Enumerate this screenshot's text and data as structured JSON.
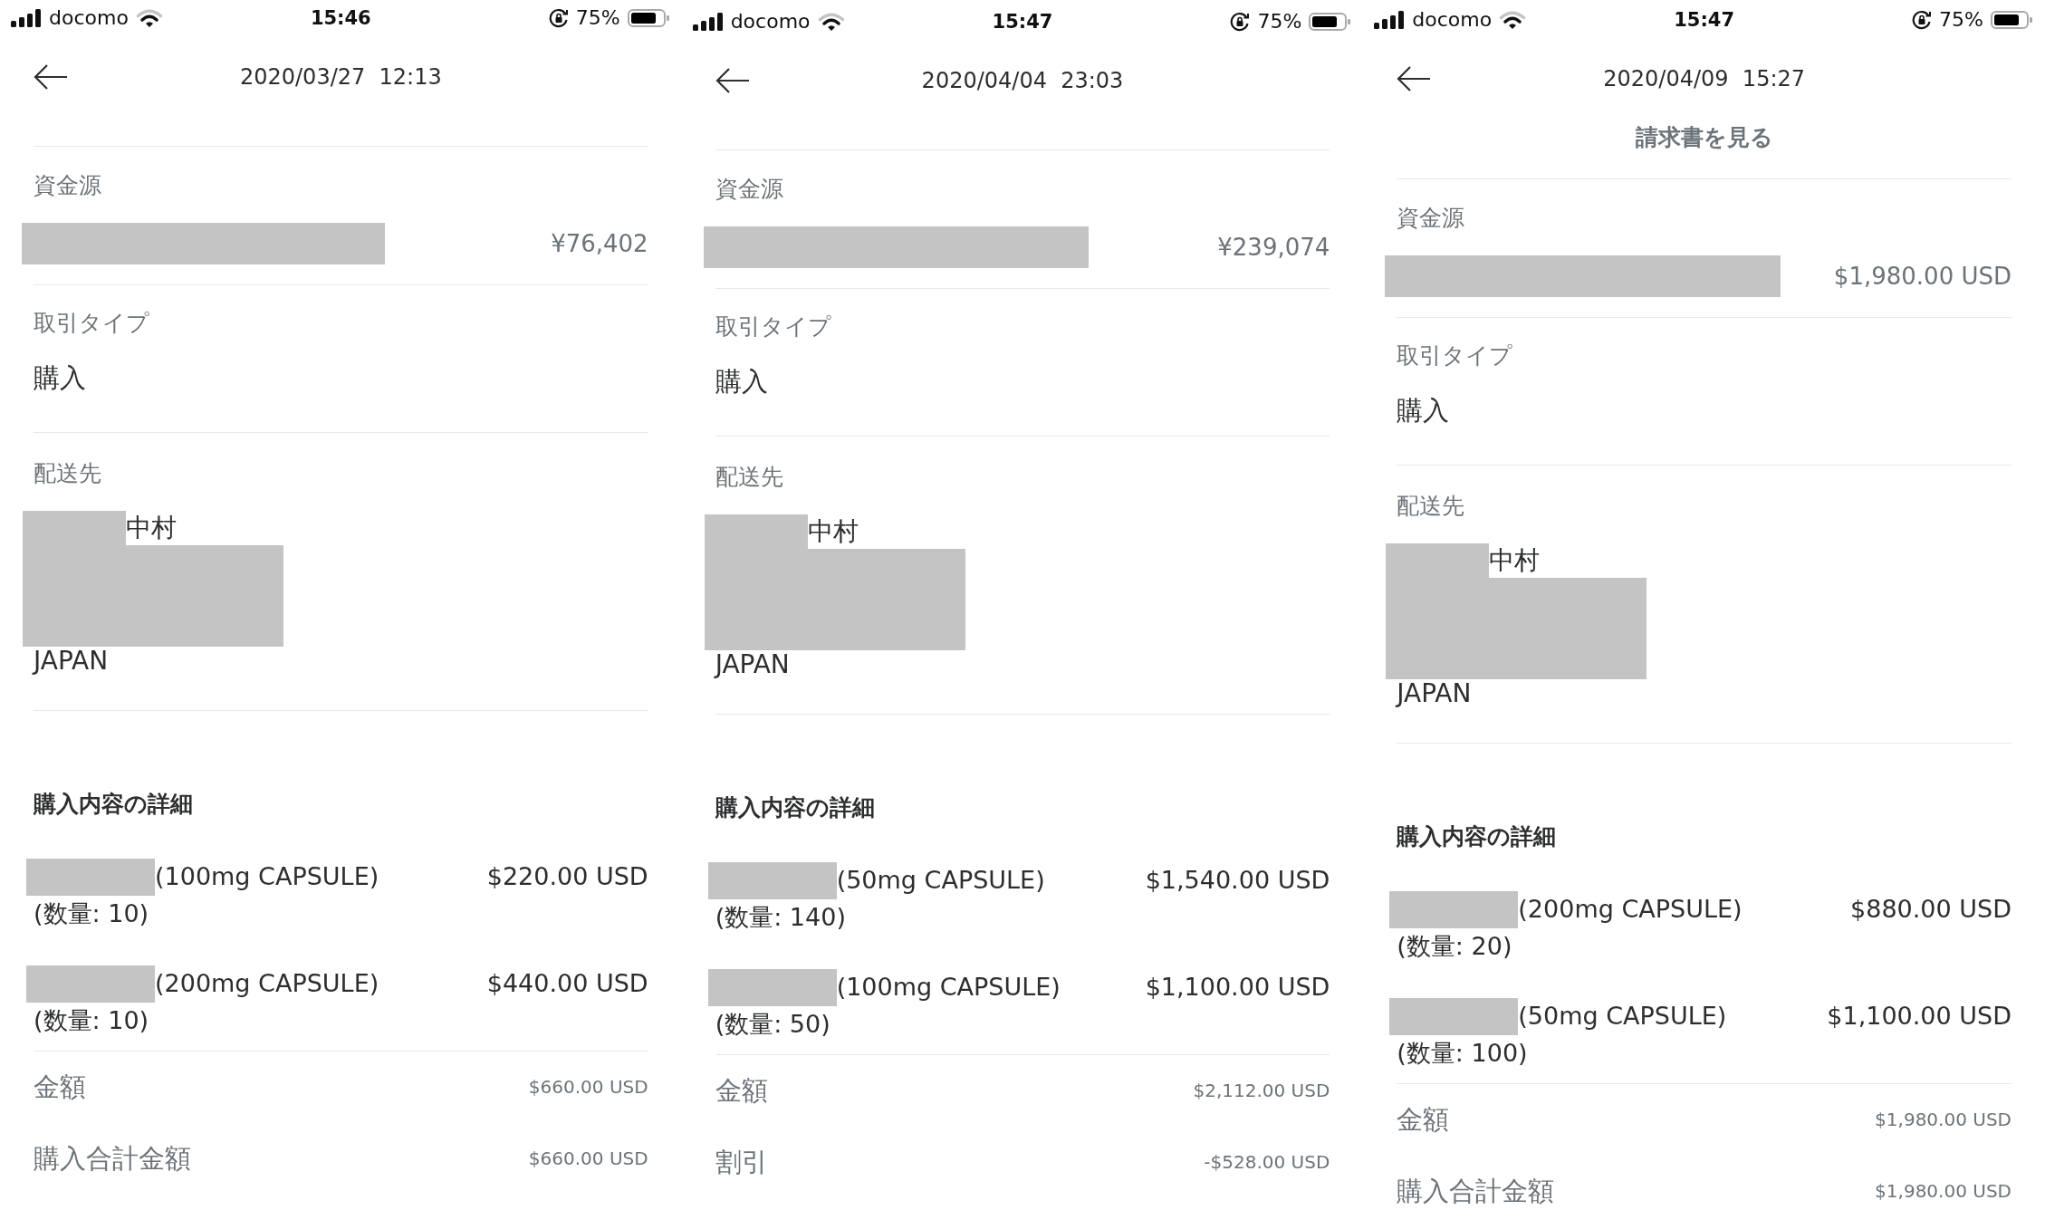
{
  "screens": [
    {
      "status_bar": {
        "carrier": "docomo",
        "time": "15:46",
        "battery": "75%"
      },
      "header": {
        "title": "2020/03/27  12:13"
      },
      "funding": {
        "label": "資金源",
        "amount": "¥76,402"
      },
      "transaction_type": {
        "label": "取引タイプ",
        "value": "購入"
      },
      "shipping": {
        "label": "配送先",
        "name": "中村",
        "country": "JAPAN"
      },
      "details": {
        "heading": "購入内容の詳細",
        "items": [
          {
            "name": "(100mg CAPSULE)",
            "price": "$220.00 USD",
            "quantity": "(数量: 10)"
          },
          {
            "name": "(200mg CAPSULE)",
            "price": "$440.00 USD",
            "quantity": "(数量: 10)"
          }
        ]
      },
      "summary": [
        {
          "label": "金額",
          "value": "$660.00 USD"
        },
        {
          "label": "購入合計金額",
          "value": "$660.00 USD"
        }
      ]
    },
    {
      "status_bar": {
        "carrier": "docomo",
        "time": "15:47",
        "battery": "75%"
      },
      "header": {
        "title": "2020/04/04  23:03"
      },
      "funding": {
        "label": "資金源",
        "amount": "¥239,074"
      },
      "transaction_type": {
        "label": "取引タイプ",
        "value": "購入"
      },
      "shipping": {
        "label": "配送先",
        "name": "中村",
        "country": "JAPAN"
      },
      "details": {
        "heading": "購入内容の詳細",
        "items": [
          {
            "name": "(50mg CAPSULE)",
            "price": "$1,540.00 USD",
            "quantity": "(数量: 140)"
          },
          {
            "name": "(100mg CAPSULE)",
            "price": "$1,100.00 USD",
            "quantity": "(数量: 50)"
          }
        ]
      },
      "summary": [
        {
          "label": "金額",
          "value": "$2,112.00 USD"
        },
        {
          "label": "割引",
          "value": "-$528.00 USD"
        }
      ]
    },
    {
      "status_bar": {
        "carrier": "docomo",
        "time": "15:47",
        "battery": "75%"
      },
      "header": {
        "title": "2020/04/09  15:27",
        "invoice_link": "請求書を見る"
      },
      "funding": {
        "label": "資金源",
        "amount": "$1,980.00 USD"
      },
      "transaction_type": {
        "label": "取引タイプ",
        "value": "購入"
      },
      "shipping": {
        "label": "配送先",
        "name": "中村",
        "country": "JAPAN"
      },
      "details": {
        "heading": "購入内容の詳細",
        "items": [
          {
            "name": "(200mg CAPSULE)",
            "price": "$880.00 USD",
            "quantity": "(数量: 20)"
          },
          {
            "name": "(50mg CAPSULE)",
            "price": "$1,100.00 USD",
            "quantity": "(数量: 100)"
          }
        ]
      },
      "summary": [
        {
          "label": "金額",
          "value": "$1,980.00 USD"
        },
        {
          "label": "購入合計金額",
          "value": "$1,980.00 USD"
        }
      ]
    }
  ]
}
